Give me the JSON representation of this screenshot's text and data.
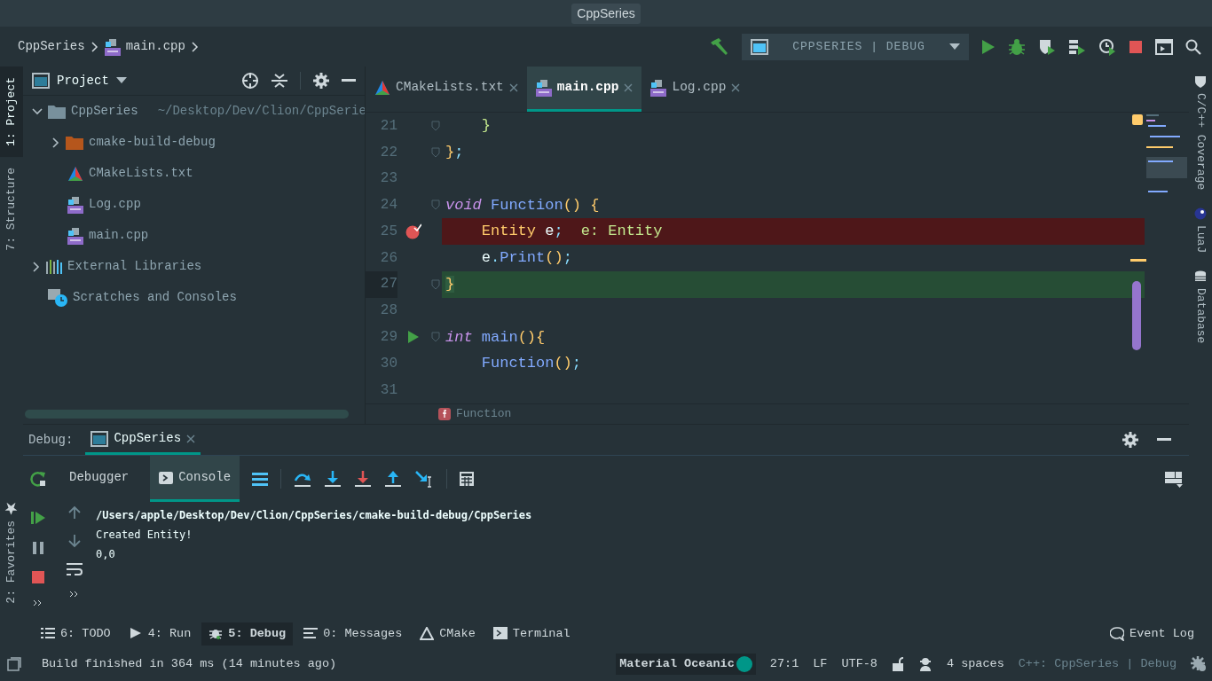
{
  "window": {
    "title": "CppSeries"
  },
  "breadcrumb": [
    {
      "label": "CppSeries",
      "kind": "project"
    },
    {
      "label": "main.cpp",
      "kind": "cpp"
    }
  ],
  "run_config": {
    "label": "CPPSERIES | DEBUG"
  },
  "left_strip": [
    {
      "label": "1: Project",
      "selected": true
    },
    {
      "label": "7: Structure",
      "selected": false
    }
  ],
  "favorites": {
    "label": "2: Favorites"
  },
  "project_panel": {
    "title": "Project",
    "tree": [
      {
        "label": "CppSeries",
        "path": "~/Desktop/Dev/Clion/CppSerie",
        "kind": "folder",
        "expanded": true,
        "children": [
          {
            "label": "cmake-build-debug",
            "kind": "build-folder",
            "expanded": false
          },
          {
            "label": "CMakeLists.txt",
            "kind": "cmake"
          },
          {
            "label": "Log.cpp",
            "kind": "cpp"
          },
          {
            "label": "main.cpp",
            "kind": "cpp"
          }
        ]
      },
      {
        "label": "External Libraries",
        "kind": "libraries",
        "expanded": false
      },
      {
        "label": "Scratches and Consoles",
        "kind": "scratches"
      }
    ]
  },
  "editor_tabs": [
    {
      "label": "CMakeLists.txt",
      "kind": "cmake",
      "selected": false
    },
    {
      "label": "main.cpp",
      "kind": "cpp",
      "selected": true
    },
    {
      "label": "Log.cpp",
      "kind": "cpp",
      "selected": false
    }
  ],
  "code": [
    {
      "number": "21",
      "fold": true,
      "breakpoint": false,
      "execution": false,
      "runnable": false,
      "tokens": [
        {
          "text": "    }",
          "kind": "brace-green"
        }
      ]
    },
    {
      "number": "22",
      "fold": true,
      "breakpoint": false,
      "execution": false,
      "runnable": false,
      "tokens": [
        {
          "text": "}",
          "kind": "brace"
        },
        {
          "text": ";",
          "kind": "punct"
        }
      ]
    },
    {
      "number": "23",
      "fold": false,
      "breakpoint": false,
      "execution": false,
      "runnable": false
    },
    {
      "number": "24",
      "fold": true,
      "breakpoint": false,
      "execution": false,
      "runnable": false,
      "tokens": [
        {
          "text": "void",
          "kind": "keyword"
        },
        {
          "text": " Function",
          "kind": "function"
        },
        {
          "text": "() {",
          "kind": "brace"
        }
      ]
    },
    {
      "number": "25",
      "fold": false,
      "breakpoint": true,
      "execution": false,
      "runnable": false,
      "tokens": [
        {
          "text": "    Entity",
          "kind": "type"
        },
        {
          "text": " e",
          "kind": "plain"
        },
        {
          "text": ";",
          "kind": "punct"
        }
      ],
      "hint": "e: Entity"
    },
    {
      "number": "26",
      "fold": false,
      "breakpoint": false,
      "execution": false,
      "runnable": false,
      "tokens": [
        {
          "text": "    e",
          "kind": "plain"
        },
        {
          "text": ".",
          "kind": "punct"
        },
        {
          "text": "Print",
          "kind": "function"
        },
        {
          "text": "()",
          "kind": "brace"
        },
        {
          "text": ";",
          "kind": "punct"
        }
      ]
    },
    {
      "number": "27",
      "fold": true,
      "breakpoint": false,
      "execution": true,
      "runnable": false,
      "tokens": [
        {
          "text": "}",
          "kind": "brace"
        }
      ]
    },
    {
      "number": "28",
      "fold": false,
      "breakpoint": false,
      "execution": false,
      "runnable": false
    },
    {
      "number": "29",
      "fold": true,
      "breakpoint": false,
      "execution": false,
      "runnable": true,
      "tokens": [
        {
          "text": "int",
          "kind": "keyword"
        },
        {
          "text": " main",
          "kind": "function"
        },
        {
          "text": "(){",
          "kind": "brace"
        }
      ]
    },
    {
      "number": "30",
      "fold": false,
      "breakpoint": false,
      "execution": false,
      "runnable": false,
      "tokens": [
        {
          "text": "    Function",
          "kind": "function"
        },
        {
          "text": "()",
          "kind": "brace"
        },
        {
          "text": ";",
          "kind": "punct"
        }
      ]
    },
    {
      "number": "31",
      "fold": false,
      "breakpoint": false,
      "execution": false,
      "runnable": false
    }
  ],
  "editor_breadcrumb": {
    "label": "Function"
  },
  "right_strip": [
    {
      "label": "C/C++ Coverage",
      "kind": "coverage"
    },
    {
      "label": "LuaJ",
      "kind": "luaj"
    },
    {
      "label": "Database",
      "kind": "database"
    }
  ],
  "debug": {
    "label": "Debug:",
    "session": "CppSeries",
    "tabs": [
      {
        "label": "Debugger",
        "selected": false
      },
      {
        "label": "Console",
        "selected": true
      }
    ],
    "console": [
      {
        "text": "/Users/apple/Desktop/Dev/Clion/CppSeries/cmake-build-debug/CppSeries",
        "kind": "command"
      },
      {
        "text": "Created Entity!",
        "kind": "output"
      },
      {
        "text": "0,0",
        "kind": "output"
      }
    ]
  },
  "tool_tabs": [
    {
      "label": "6: TODO",
      "kind": "todo",
      "selected": false
    },
    {
      "label": "4: Run",
      "kind": "run",
      "selected": false
    },
    {
      "label": "5: Debug",
      "kind": "debug",
      "selected": true
    },
    {
      "label": "0: Messages",
      "kind": "messages",
      "selected": false
    },
    {
      "label": "CMake",
      "kind": "cmake",
      "selected": false
    },
    {
      "label": "Terminal",
      "kind": "terminal",
      "selected": false
    }
  ],
  "event_log": "Event Log",
  "status_bar": {
    "message": "Build finished in 364 ms (14 minutes ago)",
    "theme": "Material Oceanic",
    "items": [
      "27:1",
      "LF",
      "UTF-8"
    ],
    "indent": "4 spaces",
    "context": "C++: CppSeries | Debug"
  }
}
